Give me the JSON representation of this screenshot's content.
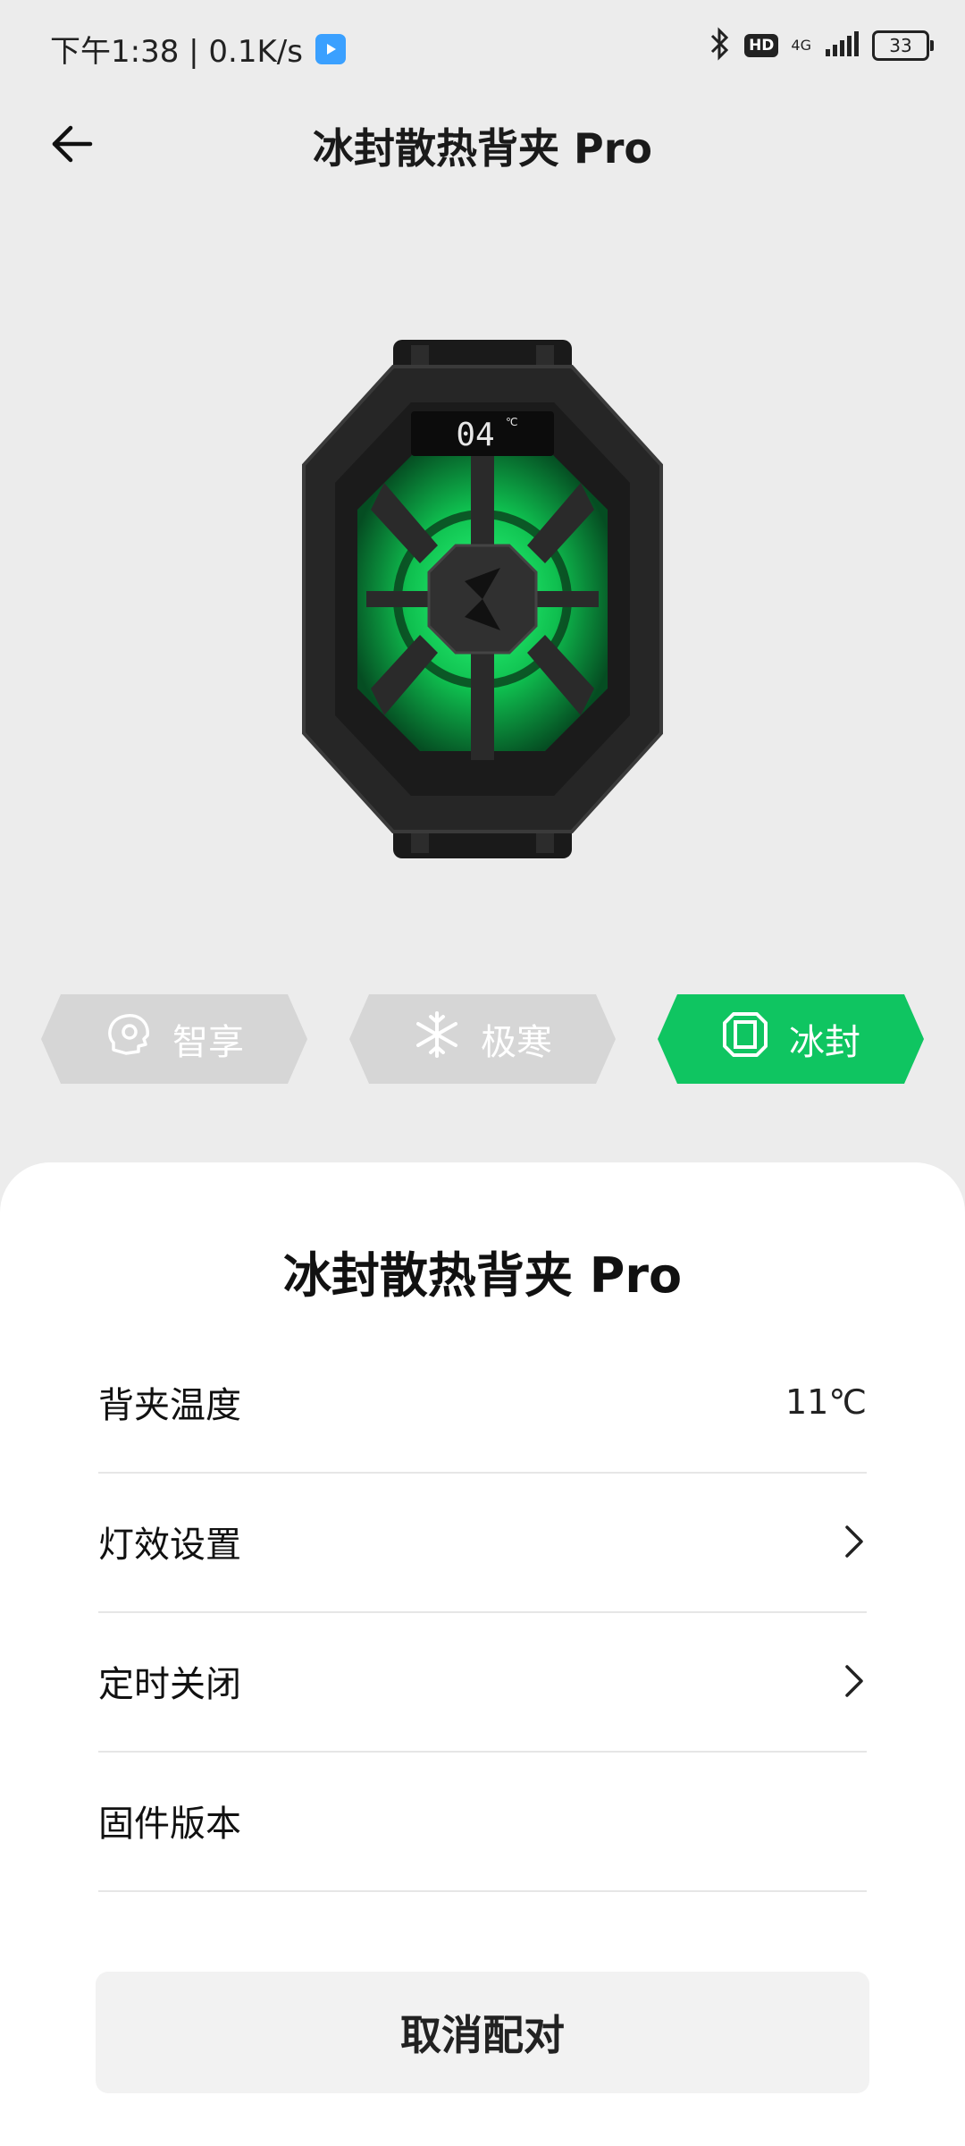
{
  "status_bar": {
    "time_speed": "下午1:38 | 0.1K/s",
    "hd": "HD",
    "network": "4G",
    "battery": "33"
  },
  "header": {
    "title": "冰封散热背夹 Pro"
  },
  "modes": [
    {
      "label": "智享",
      "icon": "smart-head-icon",
      "active": false
    },
    {
      "label": "极寒",
      "icon": "snowflake-icon",
      "active": false
    },
    {
      "label": "冰封",
      "icon": "ice-cube-icon",
      "active": true
    }
  ],
  "colors": {
    "accent": "#0fc561",
    "inactive_mode": "#d6d6d6",
    "background": "#ececec"
  },
  "sheet": {
    "title": "冰封散热背夹 Pro",
    "rows": [
      {
        "label": "背夹温度",
        "value": "11℃"
      },
      {
        "label": "灯效设置",
        "value": ""
      },
      {
        "label": "定时关闭",
        "value": ""
      },
      {
        "label": "固件版本",
        "value": ""
      }
    ],
    "cancel_label": "取消配对"
  },
  "product": {
    "display_reading": "04"
  }
}
